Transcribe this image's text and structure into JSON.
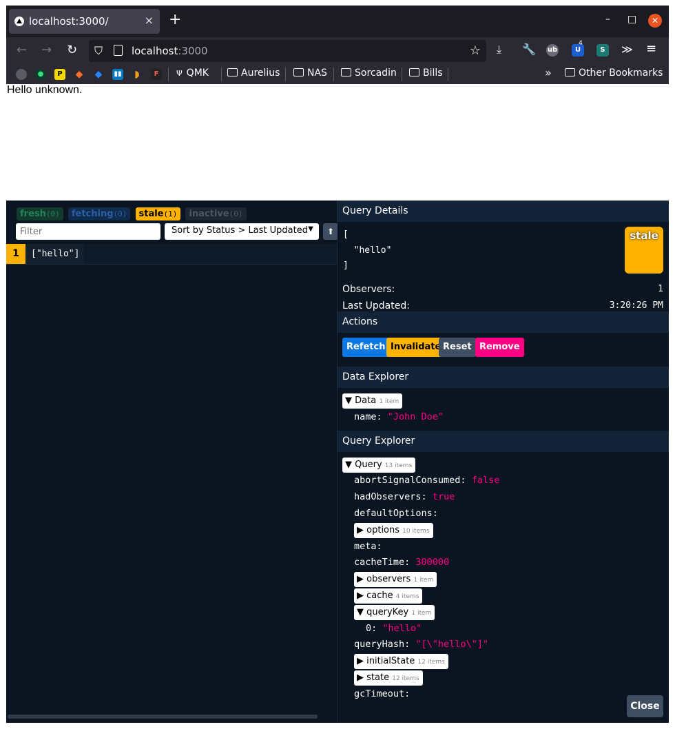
{
  "browser": {
    "tab_title": "localhost:3000/",
    "tab_close": "×",
    "new_tab": "+",
    "window_minimize": "–",
    "window_maximize": "□",
    "window_close": "✕",
    "url_host": "localhost",
    "url_port": ":3000",
    "back": "←",
    "forward": "→",
    "reload": "↻",
    "star": "☆",
    "download": "⤓",
    "more": "≫",
    "menu": "≡",
    "ext_badge": "4"
  },
  "bookmarks": {
    "items": [
      "QMK",
      "Aurelius",
      "NAS",
      "Sorcadin",
      "Bills"
    ],
    "overflow": "»",
    "other": "Other Bookmarks"
  },
  "page": {
    "text": "Hello unknown."
  },
  "devtools": {
    "filters": [
      {
        "label": "fresh",
        "count": "(0)"
      },
      {
        "label": "fetching",
        "count": "(0)"
      },
      {
        "label": "stale",
        "count": "(1)"
      },
      {
        "label": "inactive",
        "count": "(0)"
      }
    ],
    "filter_placeholder": "Filter",
    "sort_label": "Sort by Status > Last Updated",
    "sort_direction": "⬆",
    "queries": [
      {
        "observers": "1",
        "key": "[\"hello\"]"
      }
    ],
    "details": {
      "header": "Query Details",
      "key_lines": [
        "[",
        "  \"hello\"",
        "]"
      ],
      "status": "stale",
      "observers_label": "Observers:",
      "observers_value": "1",
      "last_updated_label": "Last Updated:",
      "last_updated_value": "3:20:26 PM"
    },
    "actions": {
      "header": "Actions",
      "refetch": "Refetch",
      "invalidate": "Invalidate",
      "reset": "Reset",
      "remove": "Remove"
    },
    "data_explorer": {
      "header": "Data Explorer",
      "toggle_label": "Data",
      "toggle_count": "1 item",
      "name_key": "name:",
      "name_value": "\"John Doe\""
    },
    "query_explorer": {
      "header": "Query Explorer",
      "root_label": "Query",
      "root_count": "13 items",
      "abortSignalConsumed_key": "abortSignalConsumed:",
      "abortSignalConsumed_val": "false",
      "hadObservers_key": "hadObservers:",
      "hadObservers_val": "true",
      "defaultOptions_key": "defaultOptions:",
      "options_label": "options",
      "options_count": "10 items",
      "meta_key": "meta:",
      "cacheTime_key": "cacheTime:",
      "cacheTime_val": "300000",
      "observers_label": "observers",
      "observers_count": "1 item",
      "cache_label": "cache",
      "cache_count": "4 items",
      "queryKey_label": "queryKey",
      "queryKey_count": "1 item",
      "queryKey0_key": "0:",
      "queryKey0_val": "\"hello\"",
      "queryHash_key": "queryHash:",
      "queryHash_val": "\"[\\\"hello\\\"]\"",
      "initialState_label": "initialState",
      "initialState_count": "12 items",
      "state_label": "state",
      "state_count": "12 items",
      "gcTimeout_key": "gcTimeout:"
    },
    "close": "Close"
  }
}
